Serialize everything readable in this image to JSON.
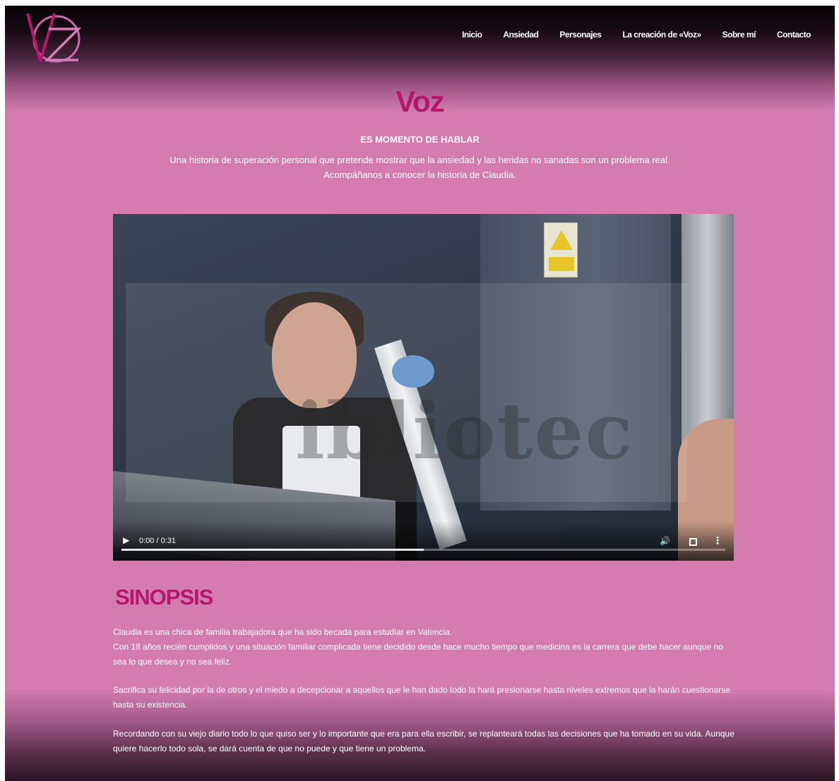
{
  "nav": {
    "items": [
      "Inicio",
      "Ansiedad",
      "Personajes",
      "La creación de «Voz»",
      "Sobre mí",
      "Contacto"
    ]
  },
  "hero": {
    "title": "Voz",
    "subtitle": "ES MOMENTO DE HABLAR",
    "tagline_line1": "Una historia de superación personal que pretende mostrar que la ansiedad y las heridas no sanadas son un problema real.",
    "tagline_line2": "Acompáñanos a conocer la historia de Claudia."
  },
  "video": {
    "time": "0:00 / 0:31",
    "progress_fraction": 0.5
  },
  "synopsis": {
    "title": "SINOPSIS",
    "p1_line1": "Claudia es una chica de familia trabajadora que ha sido becada para estudiar en Valencia.",
    "p1_line2": "Con 18 años recién cumplidos y una situación familiar complicada tiene decidido desde hace mucho tiempo que medicina es la carrera que debe hacer aunque no sea lo que desea y no sea feliz.",
    "p2": "Sacrifica su felicidad por la de otros y el miedo a decepcionar a aquellos que le han dado todo la hará presionarse hasta niveles extremos que la harán cuestionarse hasta su existencia.",
    "p3": "Recordando con su viejo diario todo lo que quiso ser y lo importante que era para ella escribir, se replanteará todas las decisiones que ha tomado en su vida. Aunque quiere hacerlo todo sola, se dará cuenta de que no puede y que tiene un problema."
  },
  "colors": {
    "page_bg": "#d47bb0",
    "accent": "#b5176f",
    "text": "#ffffff"
  },
  "icons": [
    "logo-vz-icon",
    "play-icon",
    "volume-icon",
    "fullscreen-icon",
    "more-vertical-icon"
  ]
}
